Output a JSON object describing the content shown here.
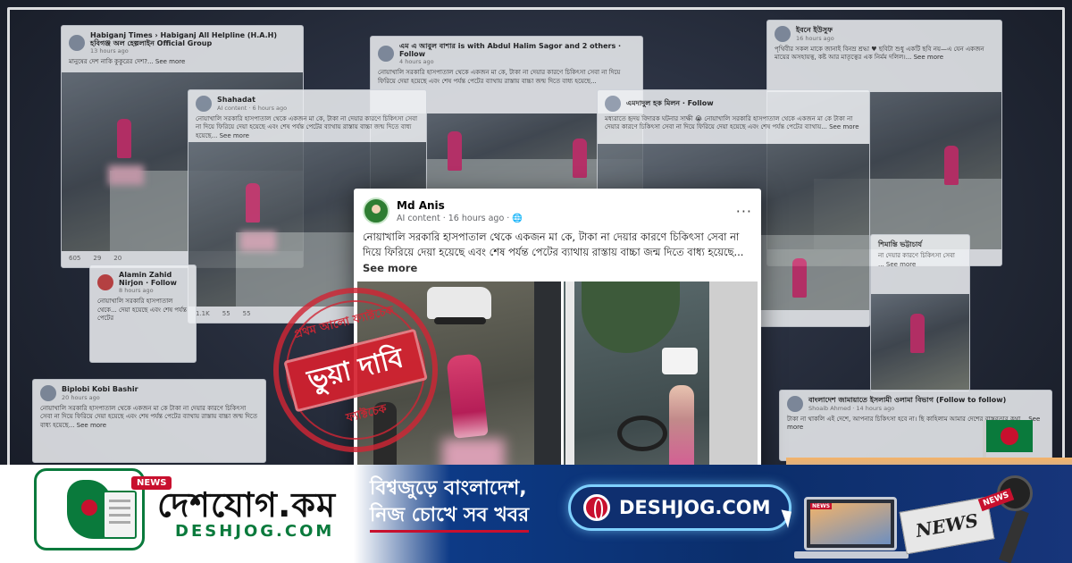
{
  "background_posts": [
    {
      "id": "p1",
      "author": "Habiganj Times › Habiganj All Helpline (H.A.H) হবিগঞ্জ অল হেল্পলাইন Official Group",
      "meta": "13 hours ago",
      "text": "মানুষের দেশ নাকি কুকুরের দেশ?... See more",
      "footer": [
        "605",
        "29",
        "20"
      ]
    },
    {
      "id": "p2",
      "author": "এম এ আবুল বাশার is with Abdul Halim Sagor and 2 others · Follow",
      "meta": "4 hours ago",
      "text": "নোয়াখালি সরকারি হাসপাতাল থেকে একজন মা কে, টাকা না দেয়ার কারণে চিকিৎসা সেবা না দিয়ে ফিরিয়ে দেয়া হয়েছে এবং শেষ পর্যন্ত পেটের ব্যাথায় রাস্তায় বাচ্চা জন্ম দিতে বাধ্য হয়েছে..."
    },
    {
      "id": "p3",
      "author": "ইবনে ইউসুফ",
      "meta": "16 hours ago",
      "text": "পৃথিবীর সকল মাকে জানাই বিনম্র শ্রদ্ধা ♥ ছবিটা শুধু একটি ছবি নয়—এ যেন একজন মায়ের অসহায়ত্ব, কষ্ট আর মাতৃত্বের এক নির্মম দলিল।... See more"
    },
    {
      "id": "p4",
      "author": "Shahadat",
      "meta": "AI content · 6 hours ago",
      "text": "নোয়াখালি সরকারি হাসপাতাল থেকে একজন মা কে, টাকা না দেয়ার কারণে চিকিৎসা সেবা না দিয়ে ফিরিয়ে দেয়া হয়েছে এবং শেষ পর্যন্ত পেটের ব্যাথায় রাস্তায় বাচ্চা জন্ম দিতে বাধ্য হয়েছে... See more",
      "footer": [
        "1.1K",
        "55",
        "55"
      ]
    },
    {
      "id": "p5",
      "author": "এমদাদুল হক মিলন · Follow",
      "meta": "",
      "text": "মধ্যরাতে হৃদয় বিদারক ঘটনার সাক্ষী 😭 নোয়াখালি সরকারি হাসপাতাল থেকে একজন মা কে টাকা না দেয়ার কারণে চিকিৎসা সেবা না দিয়ে ফিরিয়ে দেয়া হয়েছে এবং শেষ পর্যন্ত পেটের ব্যাথায়... See more"
    },
    {
      "id": "p6",
      "author": "Alamin Zahid Nirjon · Follow",
      "meta": "8 hours ago",
      "text": "নোয়াখালি সরকারি হাসপাতাল থেকে... দেয়া হয়েছে এবং শেষ পর্যন্ত পেটের"
    },
    {
      "id": "p7",
      "author": "Biplobi Kobi Bashir",
      "meta": "20 hours ago",
      "text": "নোয়াখালি সরকারি হাসপাতাল থেকে একজন মা কে টাকা না দেয়ার কারণে চিকিৎসা সেবা না দিয়ে ফিরিয়ে দেয়া হয়েছে এবং শেষ পর্যন্ত পেটের ব্যাথায় রাস্তায় বাচ্চা জন্ম দিতে বাধ্য হয়েছে... See more"
    },
    {
      "id": "p8",
      "author": "শিমান্তি ভট্টাচার্য",
      "meta": "",
      "text": "না দেয়ার কারণে চিকিৎসা সেবা ... See more"
    },
    {
      "id": "p9",
      "author": "বাংলাদেশ জামায়াতে ইসলামী ওলামা বিভাগ (Follow to follow)",
      "meta": "Shoaib Ahmed · 14 hours ago",
      "text": "টাকা না থাকলি এই দেশে, আপনার চিকিৎসা হবে না। ছি কাহিলাম আমার দেশের বাস্তবতার কথা... See more"
    }
  ],
  "main_post": {
    "author": "Md Anis",
    "meta": "AI content · 16 hours ago · 🌐",
    "more_label": "···",
    "text": "নোয়াখালি সরকারি হাসপাতাল থেকে একজন মা কে, টাকা না দেয়ার কারণে চিকিৎসা সেবা না দিয়ে ফিরিয়ে দেয়া হয়েছে এবং শেষ পর্যন্ত পেটের ব্যাথায় রাস্তায় বাচ্চা জন্ম দিতে বাধ্য হয়েছে...",
    "see_more": "See more"
  },
  "stamp": {
    "top": "প্রথম আলো ফ্যাক্টচেক",
    "label": "ভুয়া দাবি",
    "bottom": "ফ্যাক্টচেক"
  },
  "banner": {
    "logo_badge": "NEWS",
    "brand_bn": "দেশযোগ.কম",
    "brand_en": "DESHJOG.COM",
    "tagline_1": "বিশ্বজুড়ে বাংলাদেশ,",
    "tagline_2": "নিজ চোখে সব খবর",
    "url_pill": "DESHJOG.COM",
    "newspaper_text": "NEWS",
    "mic_tag": "NEWS",
    "laptop_label": "NEWS"
  },
  "colors": {
    "brand_green": "#0a7a3c",
    "brand_red": "#c8102e",
    "banner_blue": "#0d3a86",
    "stamp_red": "#d0263a"
  }
}
